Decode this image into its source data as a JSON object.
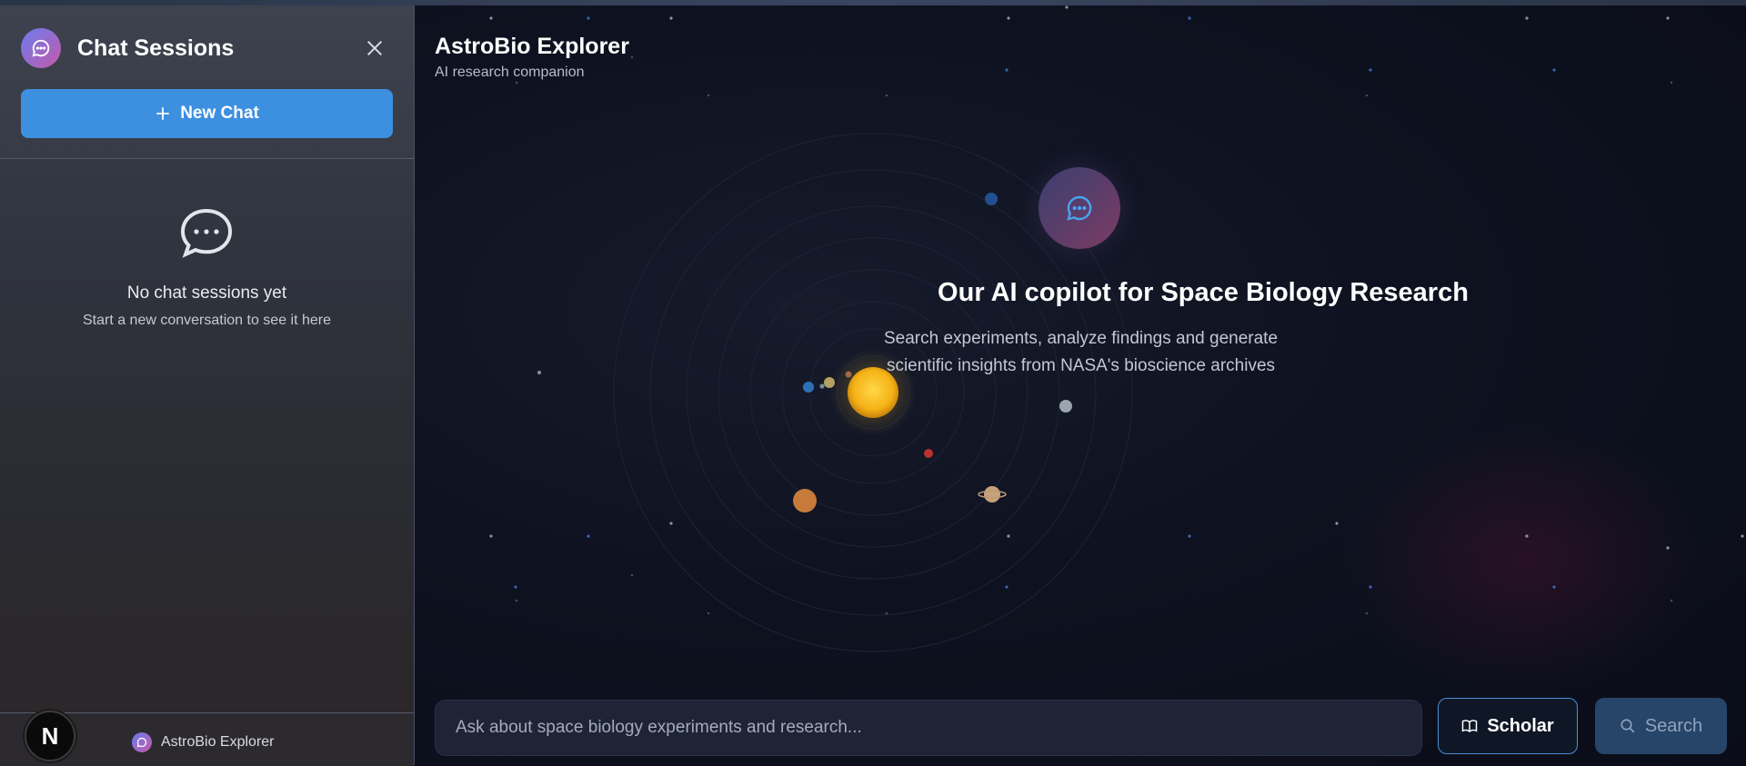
{
  "sidebar": {
    "title": "Chat Sessions",
    "new_chat_label": "New Chat",
    "empty_title": "No chat sessions yet",
    "empty_subtitle": "Start a new conversation to see it here",
    "footer_brand": "AstroBio Explorer",
    "dev_badge": "N"
  },
  "header": {
    "title": "AstroBio Explorer",
    "subtitle": "AI research companion"
  },
  "hero": {
    "title": "Our AI copilot for Space Biology Research",
    "description": "Search experiments, analyze findings and generate scientific insights from NASA's bioscience archives"
  },
  "composer": {
    "placeholder": "Ask about space biology experiments and research...",
    "scholar_label": "Scholar",
    "search_label": "Search"
  },
  "colors": {
    "accent": "#3d8fe0",
    "background": "#0b0f1a",
    "sidebar": "#343844"
  },
  "icons": [
    "chat-bubble-icon",
    "close-icon",
    "plus-icon",
    "book-icon",
    "search-icon"
  ]
}
